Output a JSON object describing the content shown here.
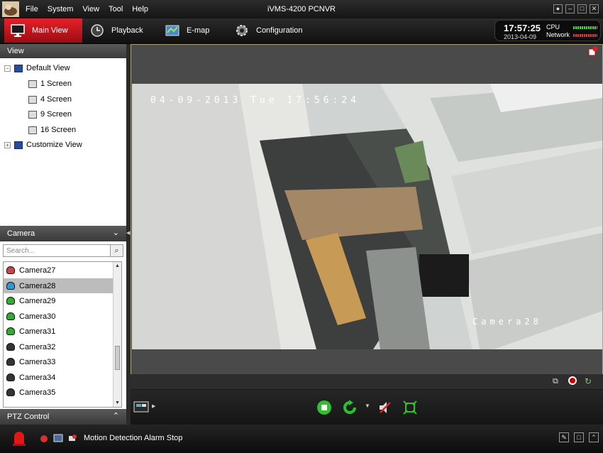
{
  "app": {
    "title": "iVMS-4200 PCNVR",
    "menu": [
      "File",
      "System",
      "View",
      "Tool",
      "Help"
    ]
  },
  "tabs": [
    {
      "label": "Main View",
      "icon": "monitor-icon"
    },
    {
      "label": "Playback",
      "icon": "playback-icon"
    },
    {
      "label": "E-map",
      "icon": "map-icon"
    },
    {
      "label": "Configuration",
      "icon": "gear-icon"
    }
  ],
  "status": {
    "time": "17:57:25",
    "date": "2013-04-09",
    "cpu_label": "CPU",
    "network_label": "Network"
  },
  "view_panel": {
    "header": "View",
    "default_view": "Default View",
    "items": [
      "1 Screen",
      "4 Screen",
      "9 Screen",
      "16 Screen"
    ],
    "customize": "Customize View"
  },
  "camera_panel": {
    "header": "Camera",
    "search_placeholder": "Search...",
    "cameras": [
      "Camera27",
      "Camera28",
      "Camera29",
      "Camera30",
      "Camera31",
      "Camera32",
      "Camera33",
      "Camera34",
      "Camera35"
    ],
    "selected": "Camera28"
  },
  "ptz": {
    "header": "PTZ Control"
  },
  "video": {
    "osd_datetime": "04-09-2013 Tue 17:56:24",
    "osd_camera": "Camera28"
  },
  "footer": {
    "alarm_text": "Motion Detection Alarm Stop"
  },
  "colors": {
    "accent": "#d8161e",
    "play_green": "#2fbf2f"
  }
}
